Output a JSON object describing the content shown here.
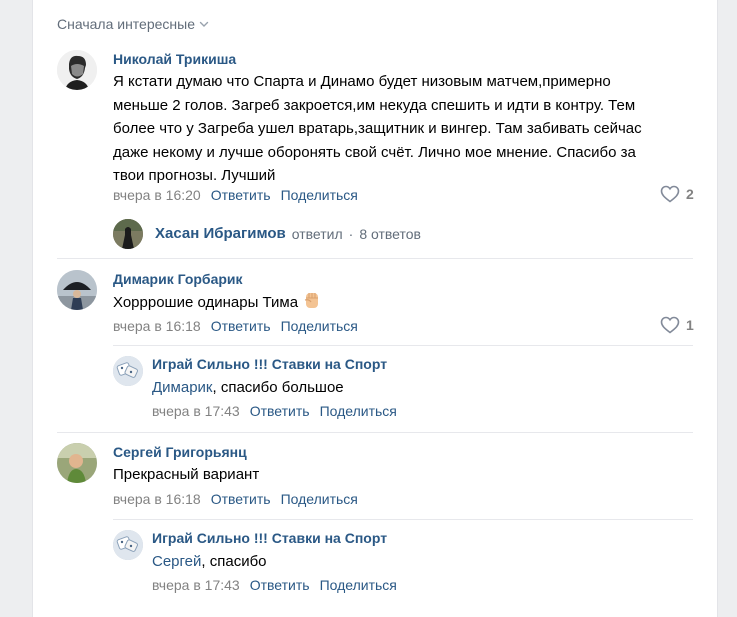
{
  "sort": {
    "label": "Сначала интересные"
  },
  "comments": [
    {
      "author": "Николай Трикиша",
      "lines": [
        "Я кстати думаю что Спарта и Динамо будет низовым матчем,примерно",
        "меньше 2 голов. Загреб закроется,им некуда спешить и идти в контру. Тем",
        "более что у Загреба ушел вратарь,защитник и вингер. Там забивать сейчас",
        "даже некому и лучше оборонять свой счёт. Лично мое мнение. Спасибо за",
        "твои прогнозы. Лучший"
      ],
      "time": "вчера в 16:20",
      "reply": "Ответить",
      "share": "Поделиться",
      "likes": "2",
      "thread": {
        "author": "Хасан Ибрагимов",
        "action": "ответил",
        "sep": "·",
        "count": "8 ответов"
      }
    },
    {
      "author": "Димарик Горбарик",
      "text": "Хорррошие одинары Тима",
      "time": "вчера в 16:18",
      "reply": "Ответить",
      "share": "Поделиться",
      "likes": "1",
      "answer": {
        "author": "Играй Сильно !!! Ставки на Спорт",
        "mention": "Димарик",
        "text": ", спасибо большое",
        "time": "вчера в 17:43",
        "reply": "Ответить",
        "share": "Поделиться"
      }
    },
    {
      "author": "Сергей Григорьянц",
      "text": "Прекрасный вариант",
      "time": "вчера в 16:18",
      "reply": "Ответить",
      "share": "Поделиться",
      "answer": {
        "author": "Играй Сильно !!! Ставки на Спорт",
        "mention": "Сергей",
        "text": ", спасибо",
        "time": "вчера в 17:43",
        "reply": "Ответить",
        "share": "Поделиться"
      }
    }
  ],
  "icons": {
    "like": "heart-icon",
    "sort": "chevron-down-icon",
    "emoji": "raised-fist-emoji"
  },
  "colors": {
    "link": "#2a5885",
    "meta": "#828282",
    "background": "#edeef0"
  }
}
